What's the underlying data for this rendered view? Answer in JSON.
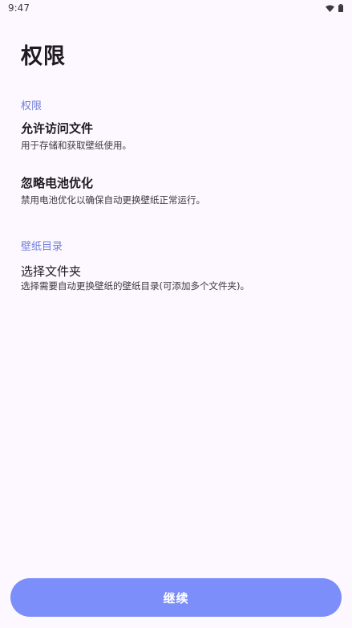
{
  "status_bar": {
    "time": "9:47",
    "icons": [
      "wifi-icon",
      "battery-icon"
    ]
  },
  "page": {
    "title": "权限"
  },
  "sections": [
    {
      "header": "权限",
      "items": [
        {
          "title": "允许访问文件",
          "summary": "用于存储和获取壁纸使用。"
        },
        {
          "title": "忽略电池优化",
          "summary": "禁用电池优化以确保自动更换壁纸正常运行。"
        }
      ]
    },
    {
      "header": "壁纸目录",
      "items": [
        {
          "title": "选择文件夹",
          "summary": "选择需要自动更换壁纸的壁纸目录(可添加多个文件夹)。"
        }
      ]
    }
  ],
  "footer": {
    "continue_label": "继续"
  },
  "colors": {
    "background": "#fdf7ff",
    "accent": "#7b8ef9",
    "section_header": "#6f7fd9"
  }
}
